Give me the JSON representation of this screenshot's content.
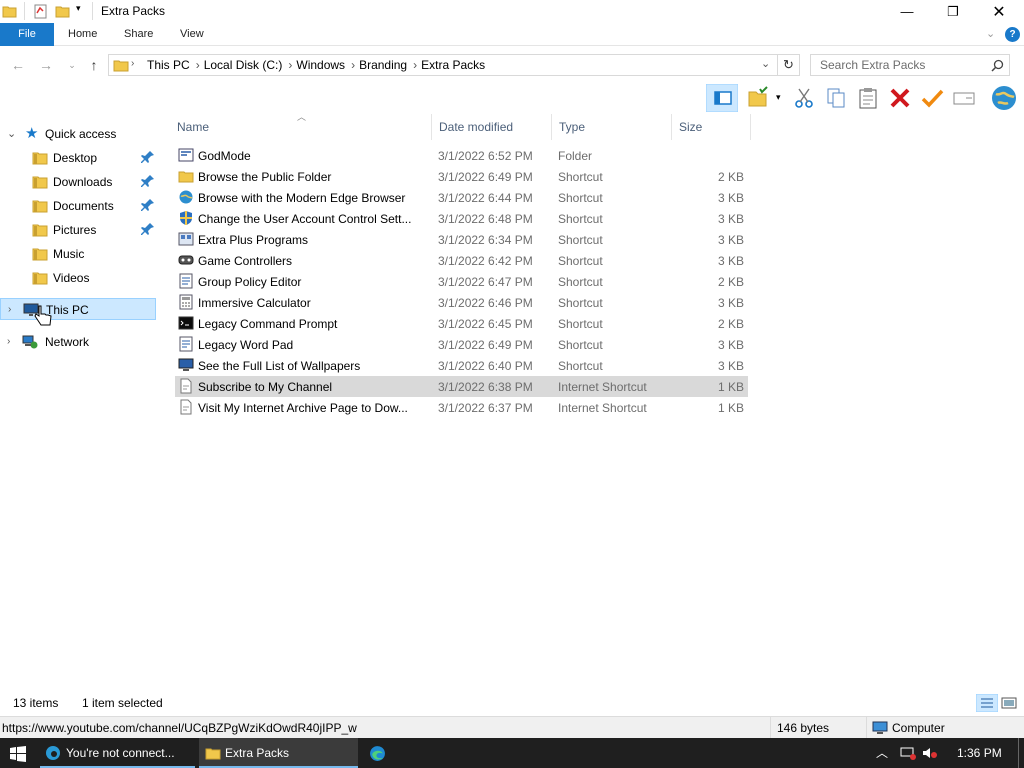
{
  "window": {
    "title": "Extra Packs"
  },
  "ribbon": {
    "tabs": [
      "File",
      "Home",
      "Share",
      "View"
    ]
  },
  "address": {
    "crumbs": [
      "This PC",
      "Local Disk (C:)",
      "Windows",
      "Branding",
      "Extra Packs"
    ],
    "search_placeholder": "Search Extra Packs"
  },
  "sidebar": {
    "quick_access": "Quick access",
    "quick_items": [
      {
        "label": "Desktop",
        "pinned": true
      },
      {
        "label": "Downloads",
        "pinned": true
      },
      {
        "label": "Documents",
        "pinned": true
      },
      {
        "label": "Pictures",
        "pinned": true
      },
      {
        "label": "Music",
        "pinned": false
      },
      {
        "label": "Videos",
        "pinned": false
      }
    ],
    "this_pc": "This PC",
    "network": "Network"
  },
  "columns": {
    "name": "Name",
    "date": "Date modified",
    "type": "Type",
    "size": "Size"
  },
  "files": [
    {
      "name": "GodMode",
      "date": "3/1/2022 6:52 PM",
      "type": "Folder",
      "size": "",
      "icon": "godmode-folder-icon"
    },
    {
      "name": "Browse the Public Folder",
      "date": "3/1/2022 6:49 PM",
      "type": "Shortcut",
      "size": "2 KB",
      "icon": "folder-shortcut-icon"
    },
    {
      "name": "Browse with the Modern Edge Browser",
      "date": "3/1/2022 6:44 PM",
      "type": "Shortcut",
      "size": "3 KB",
      "icon": "globe-shortcut-icon"
    },
    {
      "name": "Change the User Account Control Sett...",
      "date": "3/1/2022 6:48 PM",
      "type": "Shortcut",
      "size": "3 KB",
      "icon": "uac-shield-icon"
    },
    {
      "name": "Extra Plus Programs",
      "date": "3/1/2022 6:34 PM",
      "type": "Shortcut",
      "size": "3 KB",
      "icon": "programs-icon"
    },
    {
      "name": "Game Controllers",
      "date": "3/1/2022 6:42 PM",
      "type": "Shortcut",
      "size": "3 KB",
      "icon": "gamepad-icon"
    },
    {
      "name": "Group Policy Editor",
      "date": "3/1/2022 6:47 PM",
      "type": "Shortcut",
      "size": "2 KB",
      "icon": "policy-icon"
    },
    {
      "name": "Immersive Calculator",
      "date": "3/1/2022 6:46 PM",
      "type": "Shortcut",
      "size": "3 KB",
      "icon": "calculator-icon"
    },
    {
      "name": "Legacy Command Prompt",
      "date": "3/1/2022 6:45 PM",
      "type": "Shortcut",
      "size": "2 KB",
      "icon": "cmd-icon"
    },
    {
      "name": "Legacy Word Pad",
      "date": "3/1/2022 6:49 PM",
      "type": "Shortcut",
      "size": "3 KB",
      "icon": "wordpad-icon"
    },
    {
      "name": "See the Full List of Wallpapers",
      "date": "3/1/2022 6:40 PM",
      "type": "Shortcut",
      "size": "3 KB",
      "icon": "monitor-icon"
    },
    {
      "name": "Subscribe to My Channel",
      "date": "3/1/2022 6:38 PM",
      "type": "Internet Shortcut",
      "size": "1 KB",
      "icon": "url-file-icon",
      "selected": true
    },
    {
      "name": "Visit My Internet Archive Page to Dow...",
      "date": "3/1/2022 6:37 PM",
      "type": "Internet Shortcut",
      "size": "1 KB",
      "icon": "url-file-icon"
    }
  ],
  "status": {
    "items": "13 items",
    "selected": "1 item selected"
  },
  "infobar": {
    "url": "https://www.youtube.com/channel/UCqBZPgWziKdOwdR40jIPP_w",
    "size": "146 bytes",
    "zone": "Computer"
  },
  "taskbar": {
    "edge_label": "You're not connect...",
    "explorer_label": "Extra Packs",
    "time": "1:36 PM"
  },
  "colors": {
    "accent": "#1979ca",
    "selection": "#d9d9d9",
    "nav_selected": "#cce8ff",
    "taskbar": "#1f1f1f"
  }
}
